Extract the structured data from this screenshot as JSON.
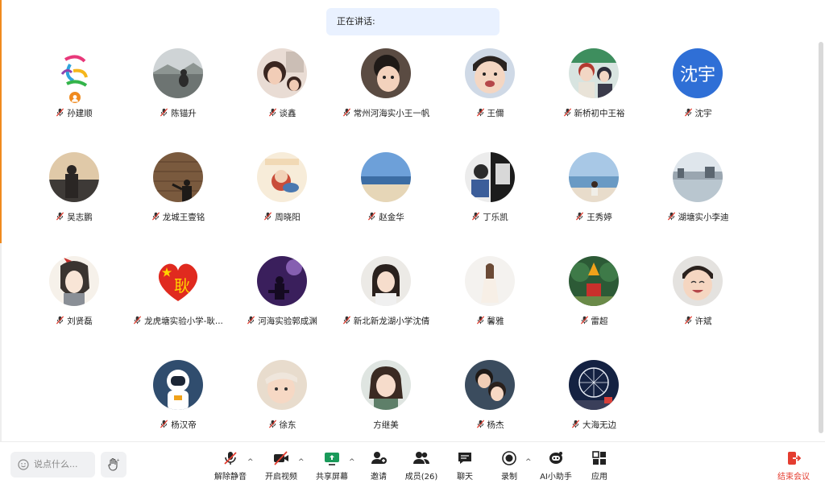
{
  "speaking": {
    "label": "正在讲话:"
  },
  "participants": [
    {
      "name": "孙建顺",
      "avatar": "logo-runner"
    },
    {
      "name": "陈锚升",
      "avatar": "photo-lake-person"
    },
    {
      "name": "谈鑫",
      "avatar": "photo-women"
    },
    {
      "name": "常州河海实小王一帆",
      "avatar": "photo-child"
    },
    {
      "name": "王儞",
      "avatar": "photo-baby-boy"
    },
    {
      "name": "新桥初中王裕",
      "avatar": "photo-anime-couple"
    },
    {
      "name": "沈宇",
      "avatar": "text",
      "text": "沈宇"
    },
    {
      "name": "吴志鹏",
      "avatar": "photo-sunset-man"
    },
    {
      "name": "龙城王壹铭",
      "avatar": "photo-brick-wall"
    },
    {
      "name": "周晓阳",
      "avatar": "cartoon-sticker"
    },
    {
      "name": "赵金华",
      "avatar": "photo-beach"
    },
    {
      "name": "丁乐凯",
      "avatar": "photo-cartoon-comic"
    },
    {
      "name": "王秀婷",
      "avatar": "photo-seaside-girl"
    },
    {
      "name": "湖塘实小李迪",
      "avatar": "photo-waterfront"
    },
    {
      "name": "刘贤磊",
      "avatar": "anime-character"
    },
    {
      "name": "龙虎塘实验小学-耿...",
      "avatar": "flag-heart",
      "text": "耿"
    },
    {
      "name": "河海实验郭成渊",
      "avatar": "photo-guitar-stage"
    },
    {
      "name": "新北新龙湖小学沈倩",
      "avatar": "photo-woman-portrait"
    },
    {
      "name": "馨雅",
      "avatar": "photo-girl-dress"
    },
    {
      "name": "雷超",
      "avatar": "photo-cartoon-tree"
    },
    {
      "name": "许斌",
      "avatar": "photo-smiling-kid"
    },
    {
      "name": "杨汉帝",
      "avatar": "astronaut"
    },
    {
      "name": "徐东",
      "avatar": "photo-baby"
    },
    {
      "name": "方继美",
      "avatar": "photo-woman-smiling",
      "muted": false
    },
    {
      "name": "杨杰",
      "avatar": "photo-couple"
    },
    {
      "name": "大海无边",
      "avatar": "photo-ferris-wheel"
    }
  ],
  "chat": {
    "placeholder": "说点什么..."
  },
  "toolbar": {
    "unmute": "解除静音",
    "video": "开启视频",
    "share": "共享屏幕",
    "invite": "邀请",
    "members": "成员(26)",
    "chat": "聊天",
    "record": "录制",
    "ai": "AI小助手",
    "apps": "应用",
    "end": "结束会议"
  },
  "colors": {
    "accent_orange": "#f08a1e",
    "end_red": "#e43d30",
    "speaking_bg": "#e9f1ff",
    "text_avatar_blue": "#2f6fd6"
  }
}
